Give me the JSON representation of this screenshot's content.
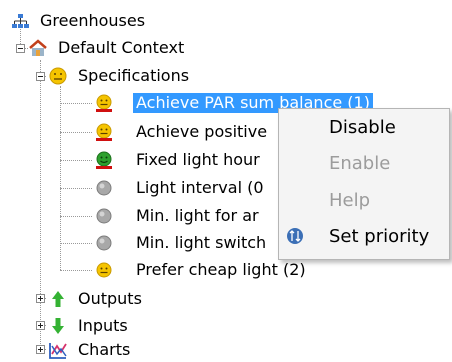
{
  "tree": {
    "root": {
      "label": "Greenhouses",
      "icon": "network-icon"
    },
    "context": {
      "label": "Default Context",
      "icon": "home-icon"
    },
    "specifications": {
      "label": "Specifications",
      "icon": "smiley-face-icon",
      "items": [
        {
          "label": "Achieve PAR sum balance (1)",
          "icon": "smiley-face-icon",
          "status_color": "#e0b000"
        },
        {
          "label": "Achieve positive",
          "icon": "smiley-face-icon",
          "status_color": "#e0b000"
        },
        {
          "label": "Fixed light hour",
          "icon": "smiley-face-icon",
          "status_color": "#2da02d"
        },
        {
          "label": "Light interval (0",
          "icon": "gray-circle-icon",
          "status_color": "#9b9b9b"
        },
        {
          "label": "Min. light for ar",
          "icon": "gray-circle-icon",
          "status_color": "#9b9b9b"
        },
        {
          "label": "Min. light switch",
          "icon": "gray-circle-icon",
          "status_color": "#9b9b9b"
        },
        {
          "label": "Prefer cheap light (2)",
          "icon": "smiley-face-icon",
          "status_color": "#e0b000"
        }
      ]
    },
    "outputs": {
      "label": "Outputs",
      "icon": "green-up-arrow-icon"
    },
    "inputs": {
      "label": "Inputs",
      "icon": "green-down-arrow-icon"
    },
    "charts": {
      "label": "Charts",
      "icon": "chart-icon"
    }
  },
  "context_menu": {
    "disable": "Disable",
    "enable": "Enable",
    "help": "Help",
    "set_priority": "Set priority",
    "priority_icon": "priority-icon"
  },
  "colors": {
    "selection": "#3399ff",
    "warning_bar": "#d01010"
  }
}
